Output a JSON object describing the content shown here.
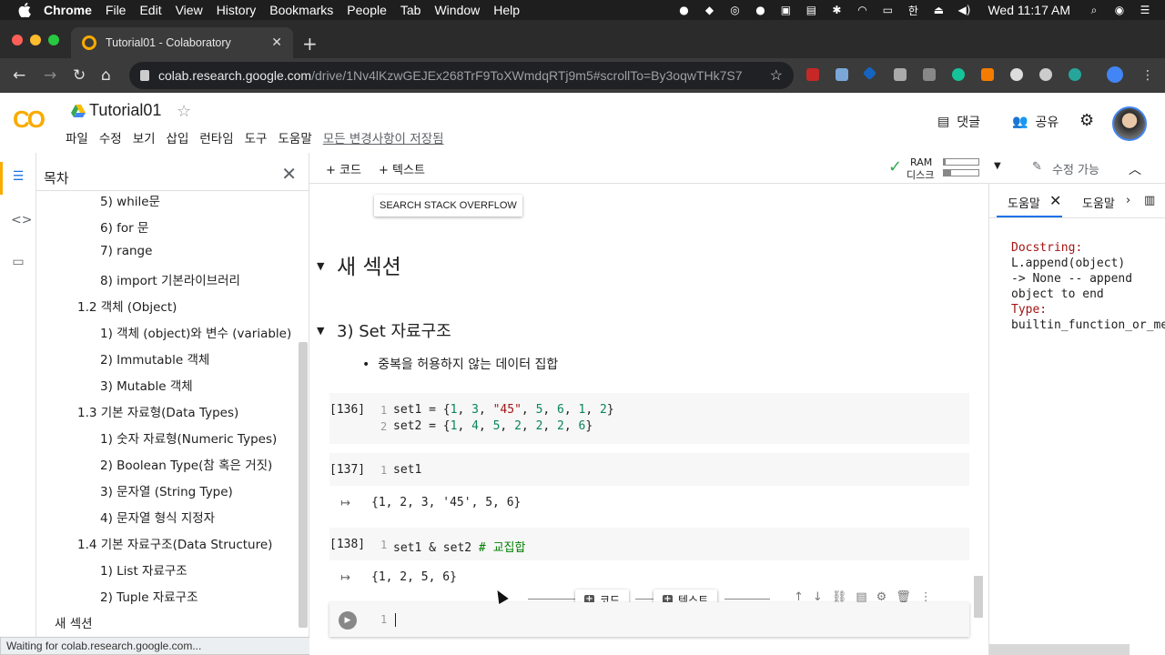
{
  "menubar": {
    "app": "Chrome",
    "items": [
      "File",
      "Edit",
      "View",
      "History",
      "Bookmarks",
      "People",
      "Tab",
      "Window",
      "Help"
    ],
    "clock": "Wed 11:17 AM",
    "status_icons": [
      "record-icon",
      "dropbox-icon",
      "app-icon",
      "notification-icon",
      "camera-icon",
      "lock-icon",
      "bluetooth-icon",
      "wifi-icon",
      "airplay-icon",
      "input-source-icon",
      "eject-icon",
      "volume-icon",
      "search-icon",
      "siri-icon",
      "list-icon"
    ]
  },
  "browser": {
    "tab_title": "Tutorial01 - Colaboratory",
    "url_host": "colab.research.google.com",
    "url_path": "/drive/1Nv4lKzwGEJEx268TrF9ToXWmdqRTj9m5#scrollTo=By3oqwTHk7S7"
  },
  "colab": {
    "logo": "CO",
    "title": "Tutorial01",
    "menus": [
      "파일",
      "수정",
      "보기",
      "삽입",
      "런타임",
      "도구",
      "도움말"
    ],
    "saved_status": "모든 변경사항이 저장됨",
    "comment_label": "댓글",
    "share_label": "공유"
  },
  "toc": {
    "title": "목차",
    "items": [
      {
        "label": "5) while문",
        "level": 3
      },
      {
        "label": "6) for 문",
        "level": 3
      },
      {
        "label": "7) range",
        "level": 3
      },
      {
        "label": "8) import 기본라이브러리",
        "level": 3
      },
      {
        "label": "1.2 객체 (Object)",
        "level": 2
      },
      {
        "label": "1) 객체 (object)와 변수 (variable)",
        "level": 3
      },
      {
        "label": "2) Immutable 객체",
        "level": 3
      },
      {
        "label": "3) Mutable 객체",
        "level": 3
      },
      {
        "label": "1.3 기본 자료형(Data Types)",
        "level": 2
      },
      {
        "label": "1) 숫자 자료형(Numeric Types)",
        "level": 3
      },
      {
        "label": "2) Boolean Type(참 혹은 거짓)",
        "level": 3
      },
      {
        "label": "3) 문자열 (String Type)",
        "level": 3
      },
      {
        "label": "4) 문자열 형식 지정자",
        "level": 3
      },
      {
        "label": "1.4 기본 자료구조(Data Structure)",
        "level": 2
      },
      {
        "label": "1) List 자료구조",
        "level": 3
      },
      {
        "label": "2) Tuple 자료구조",
        "level": 3
      },
      {
        "label": "새 섹션",
        "level": 1
      }
    ]
  },
  "status_bar": "Waiting for colab.research.google.com...",
  "toolbar": {
    "add_code": "+ 코드",
    "add_text": "+ 텍스트",
    "ram_label": "RAM",
    "disk_label": "디스크",
    "ram_usage": 0.05,
    "disk_usage": 0.2,
    "edit_mode": "수정 가능"
  },
  "notebook": {
    "so_button": "SEARCH STACK OVERFLOW",
    "section_heading": "새 섹션",
    "sub_heading": "3) Set 자료구조",
    "bullet": "중복을 허용하지 않는 데이터 집합",
    "cell1_exec": "[136]",
    "cell1_line1_no": "1",
    "cell1_line2_no": "2",
    "cell2_exec": "[137]",
    "cell2_line_no": "1",
    "cell2_code": "set1",
    "cell2_output": "{1, 2, 3, '45', 5, 6}",
    "cell3_exec": "[138]",
    "cell3_line_no": "1",
    "cell3_code": "set1 & set2",
    "cell3_comment": "# 교집합",
    "cell3_output": "{1, 2, 5, 6}",
    "empty_cell_line_no": "1",
    "add_code_btn": "코드",
    "add_text_btn": "텍스트"
  },
  "help": {
    "tab1": "도움말",
    "tab2": "도움말",
    "docstring_label": "Docstring:",
    "docstring": "L.append(object)\n-> None -- append\nobject to end",
    "type_label": "Type:",
    "type_value": "builtin_function_or_method"
  }
}
